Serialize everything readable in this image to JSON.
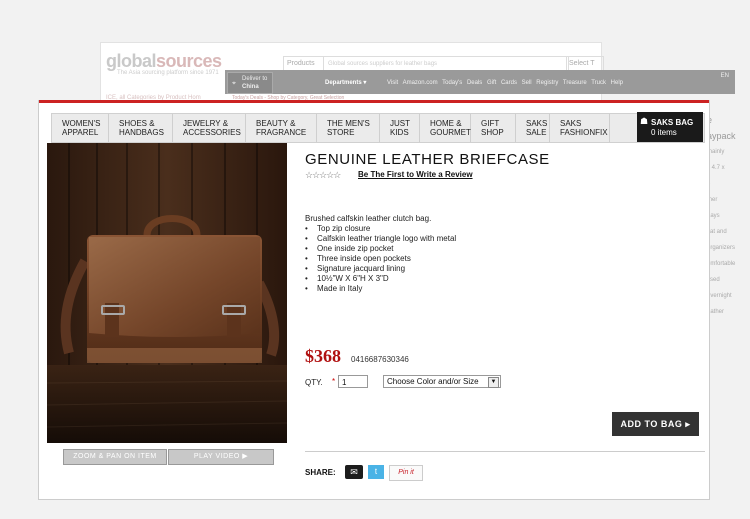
{
  "global_sources": {
    "logo_a": "global",
    "logo_b": "sources",
    "tagline": "The Asia sourcing platform since 1971",
    "category": "Products",
    "search_placeholder": "Global sources suppliers for leather bags",
    "select": "Select T",
    "links": "ICE, all Categories by Product Hom"
  },
  "amazon": {
    "deliver_to": "Deliver to",
    "deliver_country": "China",
    "departments": "Departments ▾",
    "links": "Visit Amazon.com   Today's Deals   Gift Cards   Sell   Registry   Treasure Truck   Help",
    "lang": "EN",
    "under": "Today's Deals - Shop by Category, Great Selection"
  },
  "side_snippets": [
    "e",
    "aypack",
    "mainly",
    "x 4.7 x",
    "e",
    "mer",
    "days",
    "sat and",
    "organizers",
    "omfortable",
    "ssed",
    "overnight",
    "eather"
  ],
  "colors": {
    "accent_red": "#b01010",
    "nav_bg": "#ebebeb",
    "bag_bg": "#1a1a1a"
  },
  "nav": {
    "items": [
      {
        "l1": "WOMEN'S",
        "l2": "APPAREL",
        "w": 57
      },
      {
        "l1": "SHOES &",
        "l2": "HANDBAGS",
        "w": 64
      },
      {
        "l1": "JEWELRY &",
        "l2": "ACCESSORIES",
        "w": 73
      },
      {
        "l1": "BEAUTY &",
        "l2": "FRAGRANCE",
        "w": 71
      },
      {
        "l1": "THE MEN'S",
        "l2": "STORE",
        "w": 63
      },
      {
        "l1": "JUST",
        "l2": "KIDS",
        "w": 40
      },
      {
        "l1": "HOME &",
        "l2": "GOURMET",
        "w": 51
      },
      {
        "l1": "GIFT",
        "l2": "SHOP",
        "w": 45
      },
      {
        "l1": "SAKS",
        "l2": "SALE",
        "w": 34
      },
      {
        "l1": "SAKS",
        "l2": "FASHIONFIX",
        "w": 60
      }
    ],
    "bag_title": "SAKS BAG",
    "bag_items": "0 items"
  },
  "product": {
    "title": "GENUINE LEATHER BRIEFCASE",
    "stars": "☆☆☆☆☆",
    "review_link": "Be The First to Write a Review",
    "description": "Brushed calfskin leather clutch bag.",
    "bullets": [
      "Top zip closure",
      "Calfskin leather triangle logo with metal",
      "One inside zip pocket",
      "Three inside open pockets",
      "Signature jacquard lining",
      "10½\"W X 6\"H X 3\"D",
      "Made in Italy"
    ],
    "price": "$368",
    "sku": "0416687630346",
    "qty_label": "QTY.",
    "qty_required": "*",
    "qty_value": "1",
    "color_select": "Choose Color and/or Size",
    "add_to_bag": "ADD TO BAG",
    "zoom_label": "ZOOM & PAN ON ITEM",
    "video_label": "PLAY VIDEO",
    "share_label": "SHARE:",
    "pin_label": "Pin it"
  }
}
